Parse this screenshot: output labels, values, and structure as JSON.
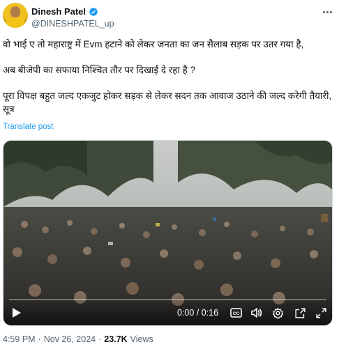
{
  "author": {
    "display_name": "Dinesh Patel",
    "handle": "@DINESHPATEL_up",
    "verified": true
  },
  "post": {
    "line1": "वो भाई ए तो महाराष्ट्र में Evm हटाने को लेकर जनता का जन सैलाब सड़क पर उतर गया है,",
    "line2": "अब बीजेपी का सफाया निश्चित तौर पर दिखाई दे रहा है ?",
    "line3": "पूरा विपक्ष बहुत जल्द एकजुट होकर सड़क से लेकर सदन तक आवाज उठाने की जल्द करेगी तैयारी, सूत्र",
    "translate_label": "Translate post"
  },
  "video": {
    "time_label": "0:00 / 0:16",
    "progress": 0.0
  },
  "meta": {
    "time": "4:59 PM",
    "separator1": "·",
    "date": "Nov 26, 2024",
    "separator2": "·",
    "views_count": "23.7K",
    "views_label": "Views"
  },
  "icons": {
    "more": "more-horizontal-icon",
    "verified": "verified-badge-icon",
    "play": "play-icon",
    "captions": "captions-icon",
    "volume": "volume-icon",
    "settings": "settings-icon",
    "popout": "popout-icon",
    "fullscreen": "fullscreen-icon"
  },
  "colors": {
    "accent": "#1d9bf0",
    "secondary_text": "#536471",
    "primary_text": "#0f1419"
  }
}
